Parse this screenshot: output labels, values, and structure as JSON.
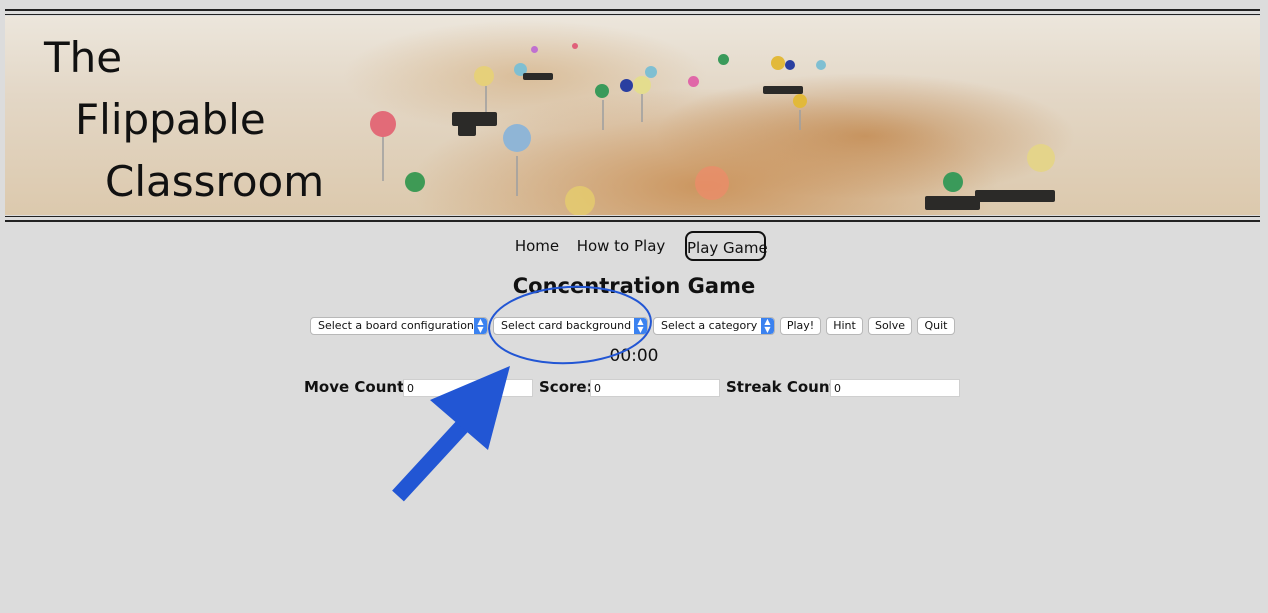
{
  "banner": {
    "title_lines": [
      "The",
      "Flippable",
      "Classroom"
    ]
  },
  "nav": {
    "items": [
      {
        "label": "Home",
        "active": false
      },
      {
        "label": "How to Play",
        "active": false
      },
      {
        "label": "Play Game",
        "active": true
      }
    ]
  },
  "game": {
    "title": "Concentration Game",
    "controls": {
      "board_select": "Select a board configuration",
      "background_select": "Select card background",
      "category_select": "Select a category",
      "play_label": "Play!",
      "hint_label": "Hint",
      "solve_label": "Solve",
      "quit_label": "Quit"
    },
    "timer": "00:00",
    "stats": {
      "move_label": "Move Count:",
      "move_value": "0",
      "score_label": "Score:",
      "score_value": "0",
      "streak_label": "Streak Count:",
      "streak_value": "0"
    }
  },
  "colors": {
    "page_bg": "#dcdcdc",
    "select_arrow": "#3b82f0",
    "annotation": "#2256d4"
  }
}
